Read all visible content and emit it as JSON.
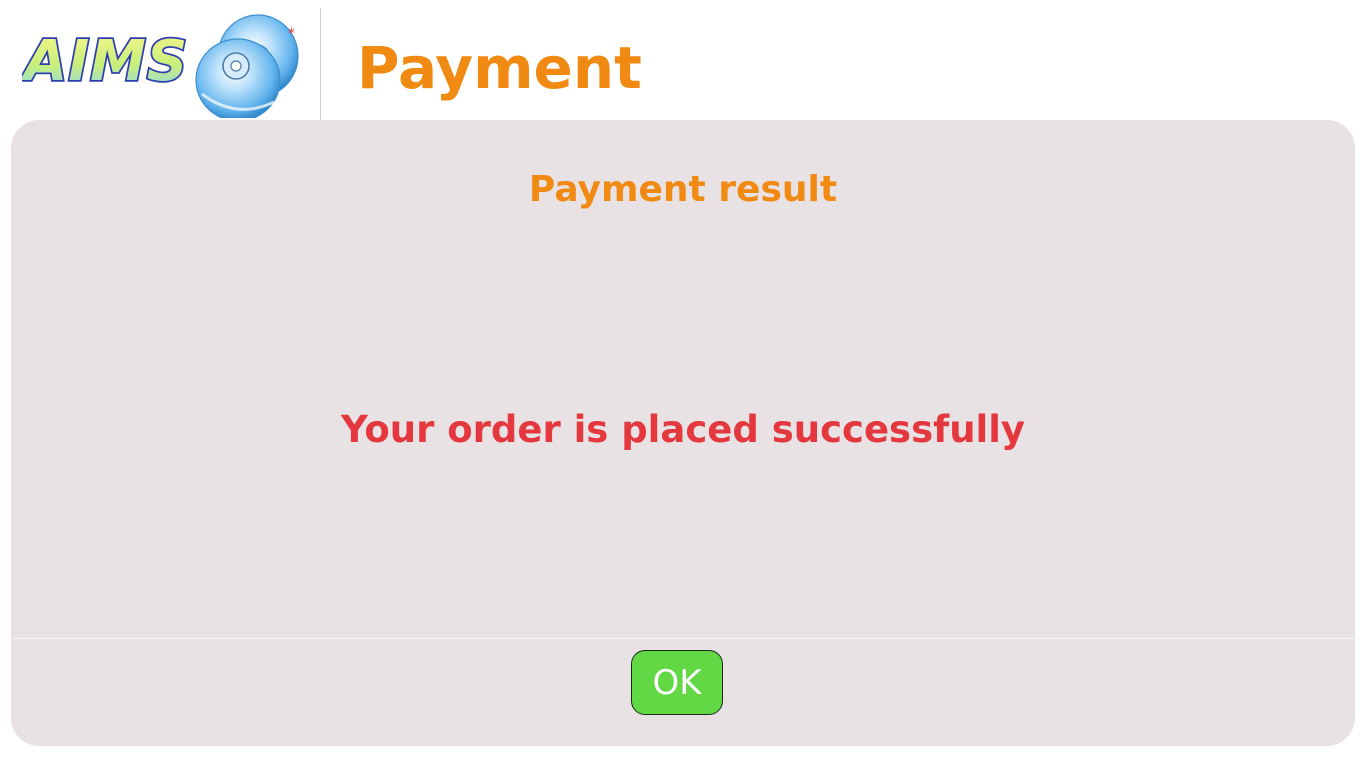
{
  "header": {
    "logo": {
      "text": "AIMS",
      "icon": "disc-icon"
    },
    "title": "Payment"
  },
  "panel": {
    "heading": "Payment result",
    "message": "Your order is placed successfully",
    "ok_label": "OK"
  },
  "colors": {
    "accent_orange": "#f08a12",
    "message_red": "#e4383e",
    "button_green": "#62d944",
    "panel_bg": "#e8e2e4"
  }
}
